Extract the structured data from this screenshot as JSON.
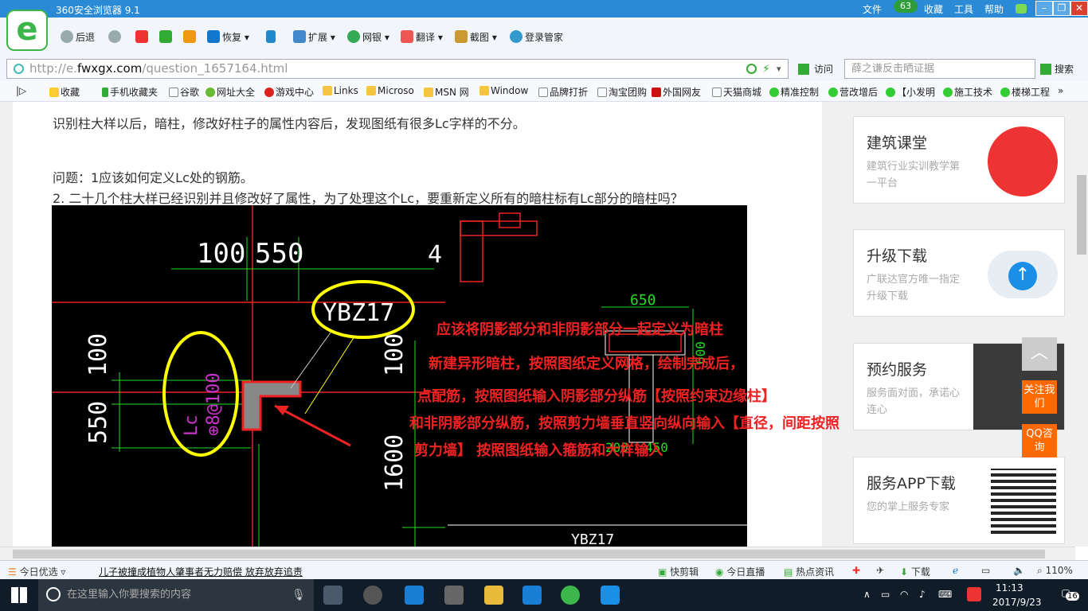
{
  "browser": {
    "title": "360安全浏览器 9.1",
    "logo_letter": "e",
    "menu": [
      "文件",
      "收藏",
      "工具",
      "帮助"
    ],
    "badge": "63",
    "toolbar": {
      "back": "后退",
      "restore": "恢复",
      "extend": "扩展",
      "bank": "网银",
      "translate": "翻译",
      "screenshot": "截图",
      "login": "登录管家"
    },
    "address": {
      "prefix": "http://e.",
      "domain": "fwxgx.com",
      "path": "/question_1657164.html"
    },
    "visit": "访问",
    "search_placeholder": "薛之谦反击晒证据",
    "search_button": "搜索",
    "bookmarks": [
      "收藏",
      "手机收藏夹",
      "谷歌",
      "网址大全",
      "游戏中心",
      "Links",
      "Microso",
      "MSN 网",
      "Window",
      "品牌打折",
      "淘宝团购",
      "外国网友",
      "天猫商城",
      "精准控制",
      "营改增后",
      "【小发明",
      "施工技术",
      "楼梯工程"
    ]
  },
  "article": {
    "line1": "识别柱大样以后，暗柱，修改好柱子的属性内容后，发现图纸有很多Lc字样的不分。",
    "line2": "问题：1应该如何定义Lc处的钢筋。",
    "line3": "2.  二十几个柱大样已经识别并且修改好了属性，为了处理这个Lc，要重新定义所有的暗柱标有Lc部分的暗柱吗？"
  },
  "cad": {
    "dims": [
      "100",
      "550",
      "4",
      "650",
      "100",
      "550",
      "100",
      "1600",
      "600",
      "200",
      "450"
    ],
    "labels": [
      "YBZ17",
      "Lc",
      "⊕8@100",
      "YBZ17"
    ],
    "answer": [
      "应该将阴影部分和非阴影部分一起定义为暗柱",
      "新建异形暗柱，按照图纸定义网格，绘制完成后，",
      "点配筋，按照图纸输入阴影部分纵筋【按照约束边缘柱】",
      "和非阴影部分纵筋，按照剪力墙垂直竖向纵向输入【直径，间距按照",
      "剪力墙】 按照图纸输入箍筋和大样输入"
    ]
  },
  "sidebar": [
    {
      "title": "建筑课堂",
      "desc": "建筑行业实训教学第一平台"
    },
    {
      "title": "升级下载",
      "desc": "广联达官方唯一指定升级下载"
    },
    {
      "title": "预约服务",
      "desc": "服务面对面，承诺心连心"
    },
    {
      "title": "服务APP下载",
      "desc": "您的掌上服务专家"
    }
  ],
  "float": {
    "follow": "关注我们",
    "qq": "QQ咨询"
  },
  "statusbar": {
    "today": "今日优选",
    "news": "儿子被撞成植物人肇事者无力赔偿 放弃放弃追责",
    "clip": "快剪辑",
    "live": "今日直播",
    "hot": "热点资讯",
    "download": "下载",
    "zoom": "110%"
  },
  "taskbar": {
    "search": "在这里输入你要搜索的内容",
    "time": "11:13",
    "date": "2017/9/23",
    "notif": "16"
  }
}
